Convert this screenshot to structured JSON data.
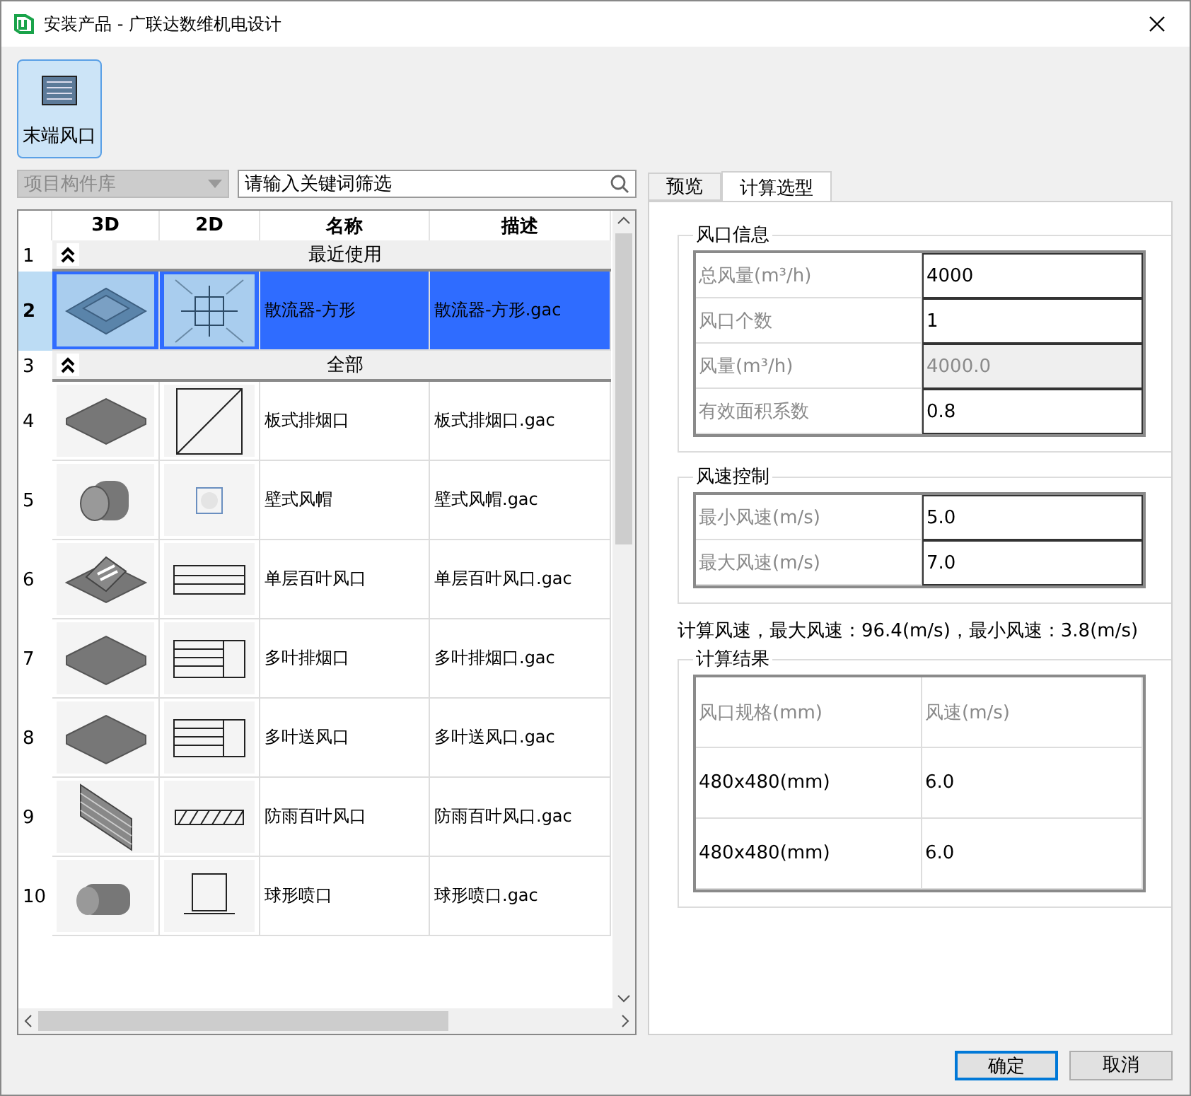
{
  "window": {
    "title": "安装产品 - 广联达数维机电设计"
  },
  "categories": [
    {
      "label": "末端风口",
      "selected": true
    }
  ],
  "library_select": {
    "value": "项目构件库",
    "disabled": true
  },
  "search": {
    "placeholder": "请输入关键词筛选"
  },
  "table": {
    "columns": [
      "3D",
      "2D",
      "名称",
      "描述"
    ],
    "rows": [
      {
        "number": "1",
        "kind": "group",
        "label": "最近使用",
        "expanded": true
      },
      {
        "number": "2",
        "kind": "item",
        "name": "散流器-方形",
        "description": "散流器-方形.gac",
        "selected": true
      },
      {
        "number": "3",
        "kind": "group",
        "label": "全部",
        "expanded": true
      },
      {
        "number": "4",
        "kind": "item",
        "name": "板式排烟口",
        "description": "板式排烟口.gac",
        "selected": false
      },
      {
        "number": "5",
        "kind": "item",
        "name": "壁式风帽",
        "description": "壁式风帽.gac",
        "selected": false
      },
      {
        "number": "6",
        "kind": "item",
        "name": "单层百叶风口",
        "description": "单层百叶风口.gac",
        "selected": false
      },
      {
        "number": "7",
        "kind": "item",
        "name": "多叶排烟口",
        "description": "多叶排烟口.gac",
        "selected": false
      },
      {
        "number": "8",
        "kind": "item",
        "name": "多叶送风口",
        "description": "多叶送风口.gac",
        "selected": false
      },
      {
        "number": "9",
        "kind": "item",
        "name": "防雨百叶风口",
        "description": "防雨百叶风口.gac",
        "selected": false
      },
      {
        "number": "10",
        "kind": "item",
        "name": "球形喷口",
        "description": "球形喷口.gac",
        "selected": false
      }
    ]
  },
  "tabs": [
    {
      "label": "预览",
      "selected": false
    },
    {
      "label": "计算选型",
      "selected": true
    }
  ],
  "outlet_info": {
    "title": "风口信息",
    "fields": [
      {
        "label": "总风量(m³/h)",
        "value": "4000",
        "disabled": false
      },
      {
        "label": "风口个数",
        "value": "1",
        "disabled": false
      },
      {
        "label": "风量(m³/h)",
        "value": "4000.0",
        "disabled": true
      },
      {
        "label": "有效面积系数",
        "value": "0.8",
        "disabled": false
      }
    ]
  },
  "speed_control": {
    "title": "风速控制",
    "fields": [
      {
        "label": "最小风速(m/s)",
        "value": "5.0",
        "disabled": false
      },
      {
        "label": "最大风速(m/s)",
        "value": "7.0",
        "disabled": false
      }
    ]
  },
  "summary": "计算风速，最大风速：96.4(m/s)，最小风速：3.8(m/s)",
  "results": {
    "title": "计算结果",
    "columns": [
      "风口规格(mm)",
      "风速(m/s)"
    ],
    "rows": [
      [
        "480x480(mm)",
        "6.0"
      ],
      [
        "480x480(mm)",
        "6.0"
      ]
    ]
  },
  "buttons": [
    {
      "label": "确定",
      "default": true
    },
    {
      "label": "取消",
      "default": false
    }
  ]
}
